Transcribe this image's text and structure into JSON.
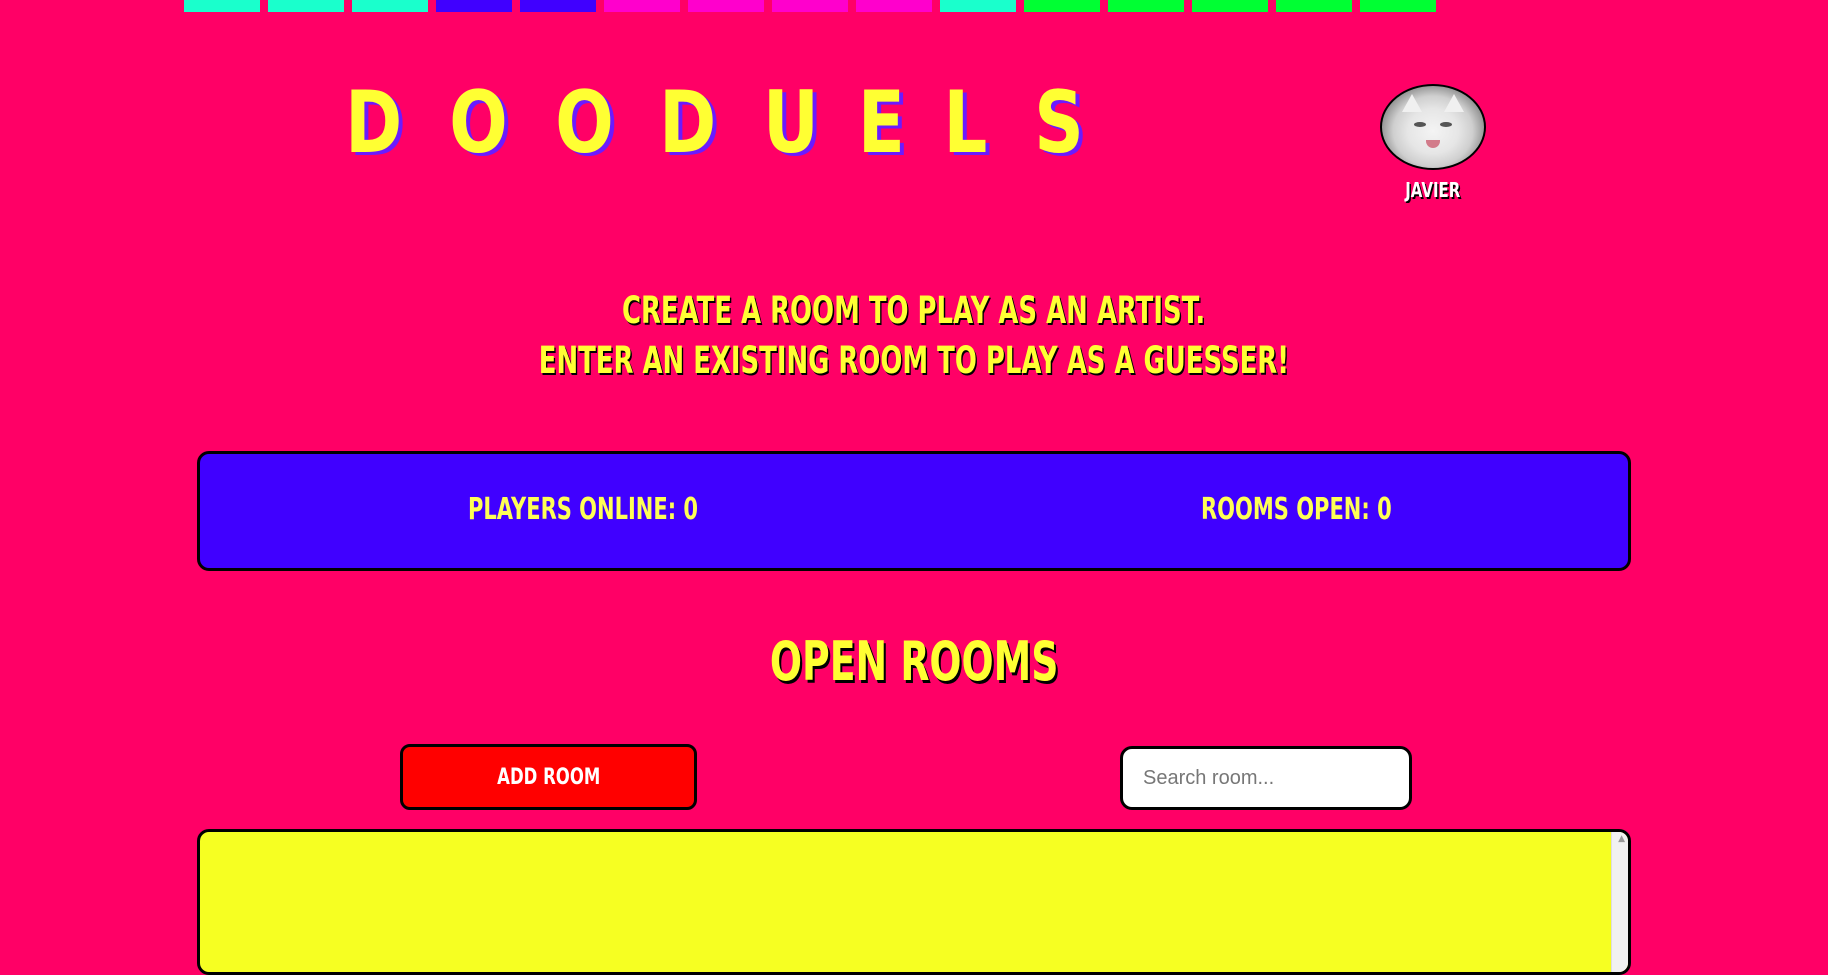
{
  "top_bar_colors": [
    "#1affcc",
    "#1affcc",
    "#1affcc",
    "#4000ff",
    "#4000ff",
    "#ff00cc",
    "#ff00cc",
    "#ff00cc",
    "#ff00cc",
    "#1affcc",
    "#00ff33",
    "#00ff33",
    "#00ff33",
    "#00ff33",
    "#00ff33"
  ],
  "header": {
    "title_letters": [
      "D",
      "O",
      "O",
      "D",
      "U",
      "E",
      "L",
      "S"
    ]
  },
  "user": {
    "name": "JAVIER",
    "avatar_icon": "cat-avatar"
  },
  "intro": {
    "line1": "CREATE A ROOM TO PLAY AS AN ARTIST.",
    "line2": "ENTER AN EXISTING ROOM TO PLAY AS A GUESSER!"
  },
  "stats": {
    "players_online": "PLAYERS ONLINE: 0",
    "rooms_open": "ROOMS OPEN: 0"
  },
  "rooms": {
    "heading": "OPEN ROOMS",
    "add_label": "ADD ROOM",
    "search_placeholder": "Search room...",
    "search_value": "",
    "items": []
  },
  "colors": {
    "background": "#ff0066",
    "title": "#ffff33",
    "title_shadow": "#6a1bff",
    "stats_bg": "#4000ff",
    "add_button": "#ff0000",
    "rooms_list_bg": "#f6ff22"
  }
}
